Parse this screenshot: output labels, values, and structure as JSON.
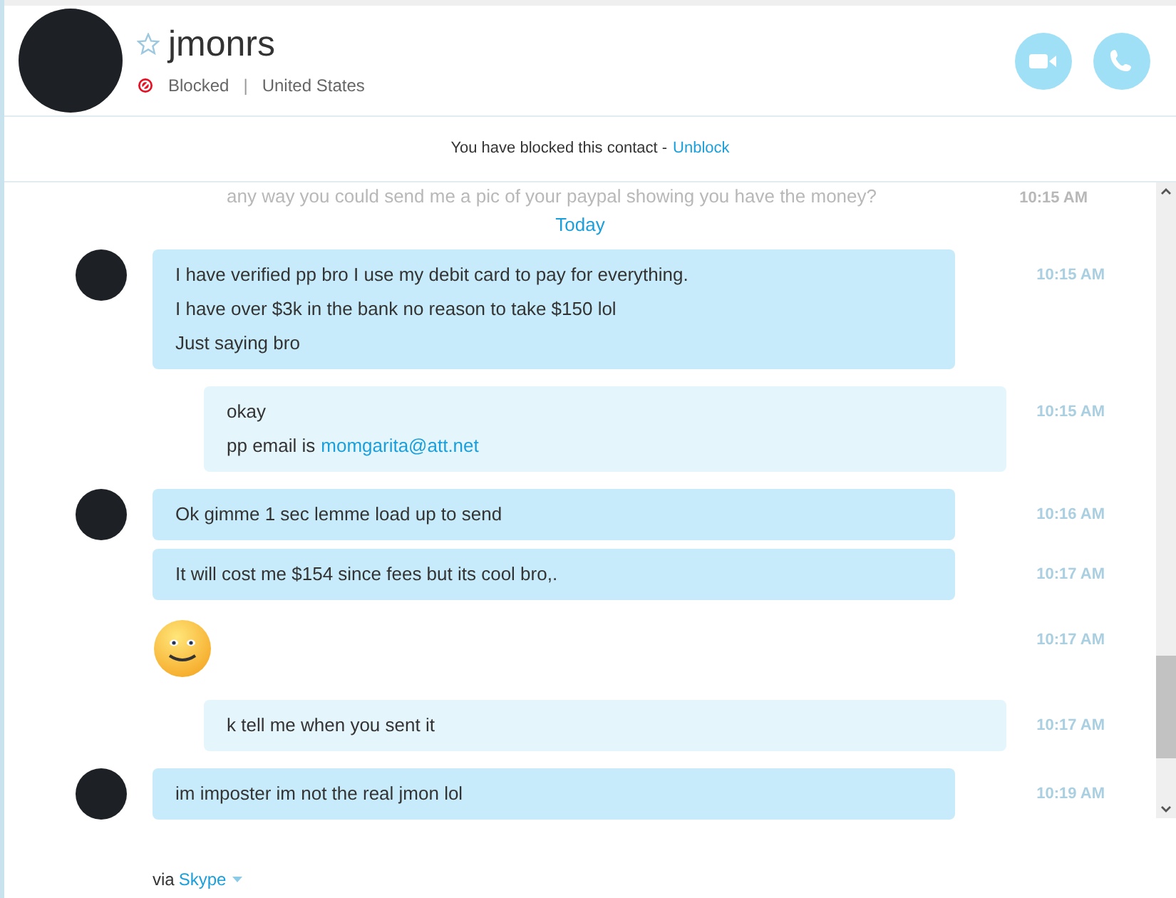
{
  "contact": {
    "name": "jmonrs",
    "favorite": false,
    "status": "Blocked",
    "separator": "|",
    "location": "United States"
  },
  "notice": {
    "text": "You have blocked this contact -",
    "link": "Unblock"
  },
  "faded_message": {
    "text": "any way you could send me a pic of your paypal showing you have the money?",
    "time": "10:15 AM"
  },
  "day_separator": "Today",
  "messages": [
    {
      "kind": "incoming",
      "avatar": true,
      "lines": [
        {
          "text": "I have verified pp bro I use my debit card to pay for everything."
        },
        {
          "text": "I have over $3k in the bank no reason to take $150 lol"
        },
        {
          "text": "Just saying bro"
        }
      ],
      "time": "10:15 AM"
    },
    {
      "kind": "outgoing",
      "avatar": false,
      "lines": [
        {
          "text": "okay"
        },
        {
          "text": "pp email is",
          "link": "momgarita@att.net"
        }
      ],
      "time": "10:15 AM"
    },
    {
      "kind": "incoming",
      "avatar": true,
      "lines": [
        {
          "text": "Ok gimme 1 sec lemme load up to send"
        }
      ],
      "time": "10:16 AM"
    },
    {
      "kind": "incoming",
      "avatar": false,
      "lines": [
        {
          "text": "It will cost me $154 since fees but its cool bro,."
        }
      ],
      "time": "10:17 AM"
    },
    {
      "kind": "emoticon",
      "avatar": false,
      "time": "10:17 AM"
    },
    {
      "kind": "outgoing",
      "avatar": false,
      "lines": [
        {
          "text": "k tell me when you sent it"
        }
      ],
      "time": "10:17 AM"
    },
    {
      "kind": "incoming",
      "avatar": true,
      "lines": [
        {
          "text": "im imposter im not the real jmon lol"
        }
      ],
      "time": "10:19 AM"
    }
  ],
  "footer": {
    "text": "via",
    "link": "Skype"
  }
}
